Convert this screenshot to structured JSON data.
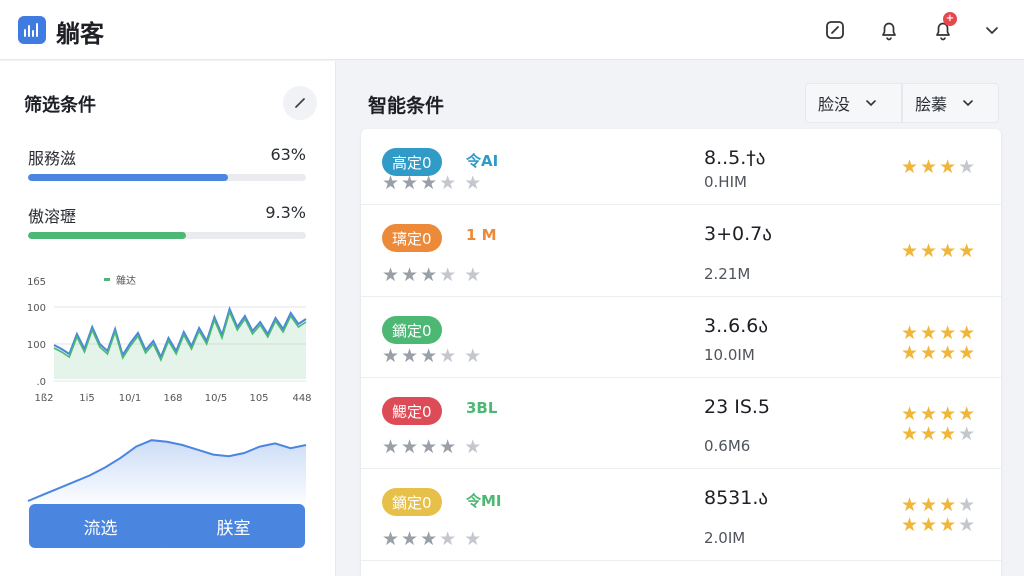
{
  "header": {
    "app_title": "躺客",
    "icons": [
      "app-logo-icon",
      "edit-icon",
      "bell-icon",
      "bell-badge-icon",
      "chevron-down-icon"
    ],
    "badge_text": "+"
  },
  "sidebar": {
    "title": "筛选条件",
    "metrics": [
      {
        "label": "服務滋",
        "value": "63%",
        "fraction": 0.72,
        "color": "#4a86e0"
      },
      {
        "label": "傲溶瓑",
        "value": "9.3%",
        "fraction": 0.57,
        "color": "#4cb874"
      }
    ],
    "buttons": {
      "filter": "流选",
      "reset": "朕室"
    }
  },
  "chart_data": [
    {
      "type": "line",
      "title": "",
      "legend": [
        "雜达"
      ],
      "yticks": [
        "1б5",
        "100",
        "100",
        ".0"
      ],
      "xticks": [
        "1ß2",
        "1i5",
        "10/1",
        "168",
        "10/5",
        "105",
        "448"
      ],
      "series": [
        {
          "name": "雜达",
          "values": [
            34,
            30,
            25,
            45,
            30,
            52,
            35,
            28,
            50,
            24,
            36,
            46,
            29,
            38,
            22,
            41,
            28,
            47,
            33,
            51,
            38,
            62,
            44,
            70,
            52,
            63,
            48,
            57,
            45,
            61,
            50,
            66,
            55,
            60
          ]
        }
      ]
    },
    {
      "type": "area",
      "title": "",
      "series": [
        {
          "name": "",
          "values": [
            10,
            18,
            26,
            34,
            42,
            52,
            64,
            78,
            86,
            84,
            80,
            74,
            68,
            66,
            70,
            78,
            82,
            76,
            80
          ]
        }
      ]
    }
  ],
  "main": {
    "title": "智能条件",
    "dropdowns": [
      "脸没",
      "脍蓁"
    ],
    "rows": [
      {
        "tag": "高定0",
        "tag_color": "#2f9bc6",
        "extra": "令AI",
        "extra_color": "#2f9bc6",
        "value": "8..5.†ა",
        "sub": "0.НIM",
        "stars_left": 3,
        "stars_right": 3
      },
      {
        "tag": "璃定0",
        "tag_color": "#ec8a3a",
        "extra": "1 M",
        "extra_color": "#ec8a3a",
        "value": "3+0.7ა",
        "sub": "2.21M",
        "stars_left": 3,
        "stars_right": 4
      },
      {
        "tag": "鏑定0",
        "tag_color": "#4cb874",
        "extra": "",
        "extra_color": "#4cb874",
        "value": "3..6.6ა",
        "sub": "10.0IM",
        "stars_left": 3,
        "stars_right": 4
      },
      {
        "tag": "鰓定0",
        "tag_color": "#dd4b56",
        "extra": "3BL",
        "extra_color": "#4cb874",
        "value": "23 IS.5",
        "sub": "0.6M6",
        "stars_left": 4,
        "stars_right": 4
      },
      {
        "tag": "鏑定0",
        "tag_color": "#e7c04a",
        "extra": "令MI",
        "extra_color": "#4cb874",
        "value": "8531.ა",
        "sub": "2.0IM",
        "stars_left": 3,
        "stars_right": 3
      }
    ]
  }
}
